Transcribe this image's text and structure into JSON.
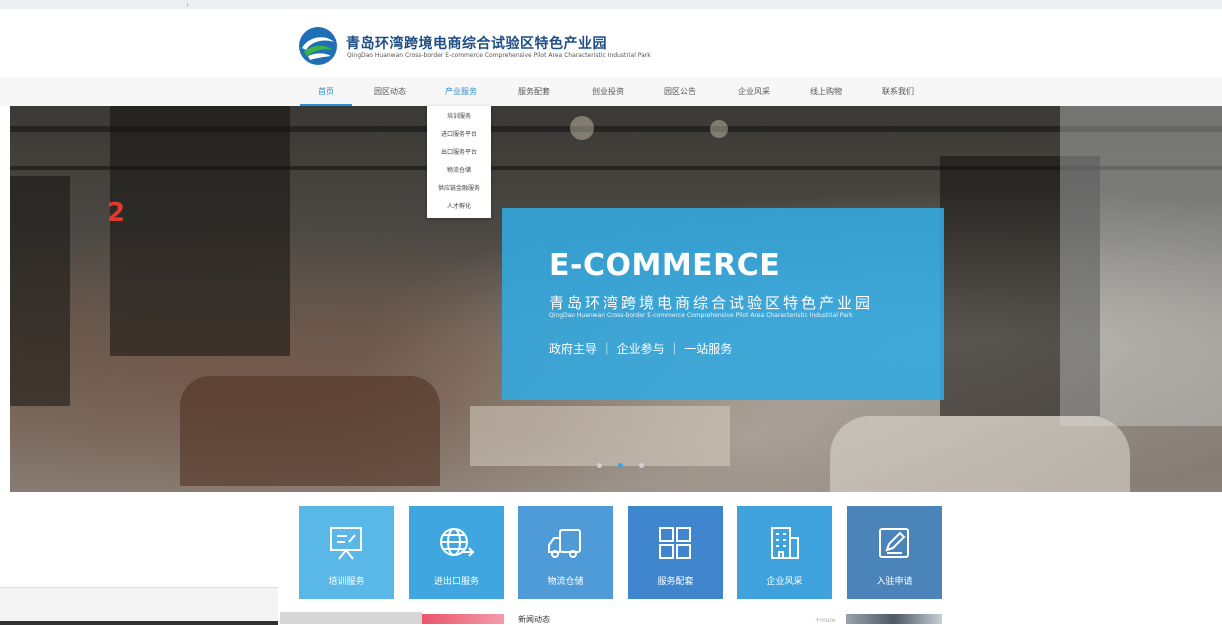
{
  "brand": {
    "name_cn": "青岛环湾跨境电商综合试验区特色产业园",
    "name_en": "QingDao Huanwan Cross-border E-commerce Comprehensive Pilot Area Characteristic Industrial Park"
  },
  "nav": {
    "items": [
      {
        "label": "首页"
      },
      {
        "label": "园区动态"
      },
      {
        "label": "产业服务"
      },
      {
        "label": "服务配套"
      },
      {
        "label": "创业投资"
      },
      {
        "label": "园区公告"
      },
      {
        "label": "企业风采"
      },
      {
        "label": "线上购物"
      },
      {
        "label": "联系我们"
      }
    ],
    "active": "首页"
  },
  "dropdown": {
    "items": [
      "培训服务",
      "进口服务平台",
      "出口服务平台",
      "物流仓储",
      "供应链金融服务",
      "人才孵化"
    ]
  },
  "hero": {
    "slide_number": "2",
    "overlay_title": "E-COMMERCE",
    "overlay_cn": "青岛环湾跨境电商综合试验区特色产业园",
    "overlay_en": "QingDao Huanwan Cross-border E-commerce Comprehensive Pilot Area Characteristic Industrial Park",
    "overlay_tagline": "政府主导 ｜ 企业参与 ｜ 一站服务",
    "slides_total": 3,
    "slide_active_index": 1
  },
  "services": [
    {
      "label": "培训服务",
      "icon": "presentation-board-icon",
      "color": "#5ab8e8"
    },
    {
      "label": "进出口服务",
      "icon": "globe-exchange-icon",
      "color": "#3fa6e0"
    },
    {
      "label": "物流仓储",
      "icon": "truck-icon",
      "color": "#4f9bd8"
    },
    {
      "label": "服务配套",
      "icon": "grid-squares-icon",
      "color": "#3f86cf"
    },
    {
      "label": "企业风采",
      "icon": "building-icon",
      "color": "#3fa2dd"
    },
    {
      "label": "入驻申请",
      "icon": "edit-pen-icon",
      "color": "#4a84b8"
    }
  ],
  "news": {
    "tab_label": "新闻动态",
    "more_label": "+more"
  },
  "colors": {
    "accent": "#2a8fd6",
    "overlay": "#32aae1",
    "slide_number": "#e03a2f"
  }
}
